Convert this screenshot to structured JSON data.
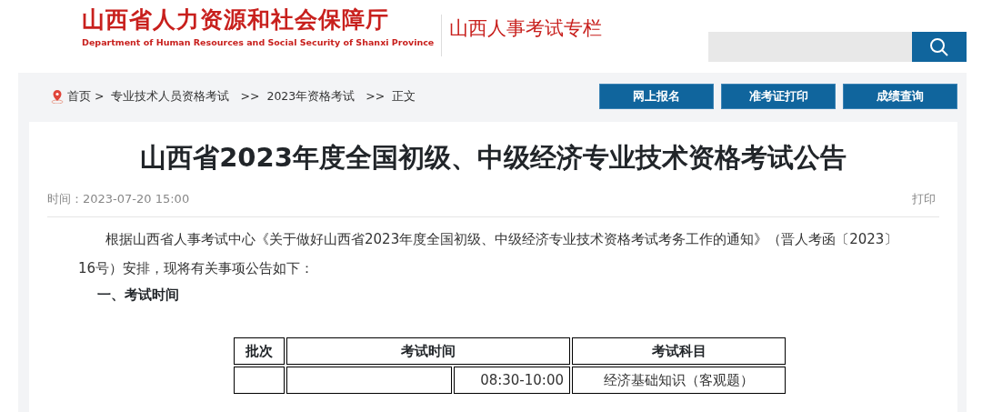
{
  "header": {
    "title": "山西省人力资源和社会保障厅",
    "subtitle": "Department of Human Resources and Social Security of Shanxi Province",
    "column_title": "山西人事考试专栏"
  },
  "breadcrumb": [
    {
      "label": "首页"
    },
    {
      "sep": ">",
      "label": "专业技术人员资格考试"
    },
    {
      "sep": ">>",
      "label": "2023年资格考试"
    },
    {
      "sep": ">>",
      "label": "正文"
    }
  ],
  "nav_buttons": [
    "网上报名",
    "准考证打印",
    "成绩查询"
  ],
  "article": {
    "title": "山西省2023年度全国初级、中级经济专业技术资格考试公告",
    "time": "时间：2023-07-20 15:00",
    "print": "打印",
    "paragraphs": [
      "根据山西省人事考试中心《关于做好山西省2023年度全国初级、中级经济专业技术资格考试考务工作的通知》（晋人考函〔2023〕16号）安排，现将有关事项公告如下："
    ],
    "heading": "一、考试时间",
    "table": {
      "columns": [
        "批次",
        "考试时间",
        "考试科目"
      ],
      "rows": [
        {
          "time": "08:30-10:00",
          "subject": "经济基础知识（客观题）"
        }
      ]
    }
  }
}
